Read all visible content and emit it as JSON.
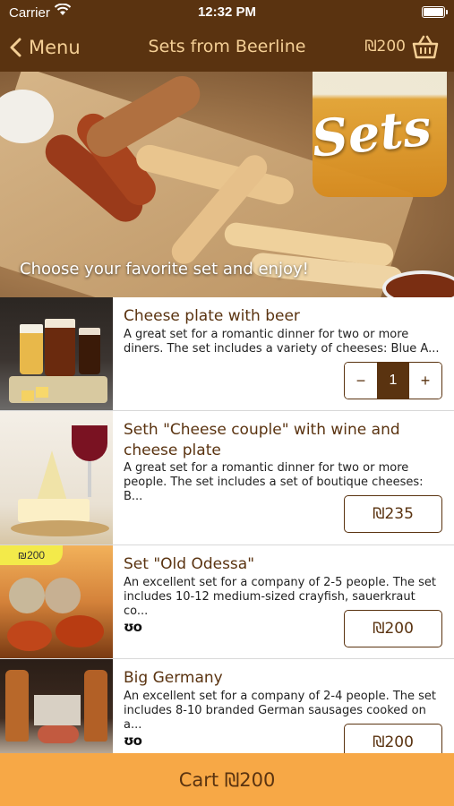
{
  "status": {
    "carrier": "Carrier",
    "time": "12:32 PM"
  },
  "nav": {
    "back_label": "Menu",
    "title": "Sets from Beerline",
    "cart_total": "₪200"
  },
  "hero": {
    "title": "Sets",
    "subtitle": "Choose your favorite set and enjoy!"
  },
  "items": [
    {
      "name": "Cheese plate with beer",
      "description": "A great set for a romantic dinner for two or more diners. The set includes a variety of cheeses: Blue A...",
      "quantity": "1",
      "minus": "−",
      "plus": "+"
    },
    {
      "name": "Seth \"Cheese couple\" with wine and cheese plate",
      "description": "A great set for a romantic dinner for two or more people. The set includes a set of boutique cheeses: B...",
      "price": "₪235"
    },
    {
      "name": "Set \"Old Odessa\"",
      "description": "An excellent set for a company of 2-5 people. The set includes 10-12 medium-sized crayfish, sauerkraut co...",
      "price": "₪200",
      "badge": "₪200",
      "icon_glyph": "ʊo"
    },
    {
      "name": "Big Germany",
      "description": "An excellent set for a company of 2-4 people. The set includes 8-10 branded German sausages cooked on a...",
      "price": "₪200",
      "icon_glyph": "ʊo"
    }
  ],
  "cart_bar": {
    "label": "Cart ₪200"
  },
  "colors": {
    "header": "#5a3310",
    "accent": "#f7a846",
    "text_brown": "#5a3310"
  }
}
